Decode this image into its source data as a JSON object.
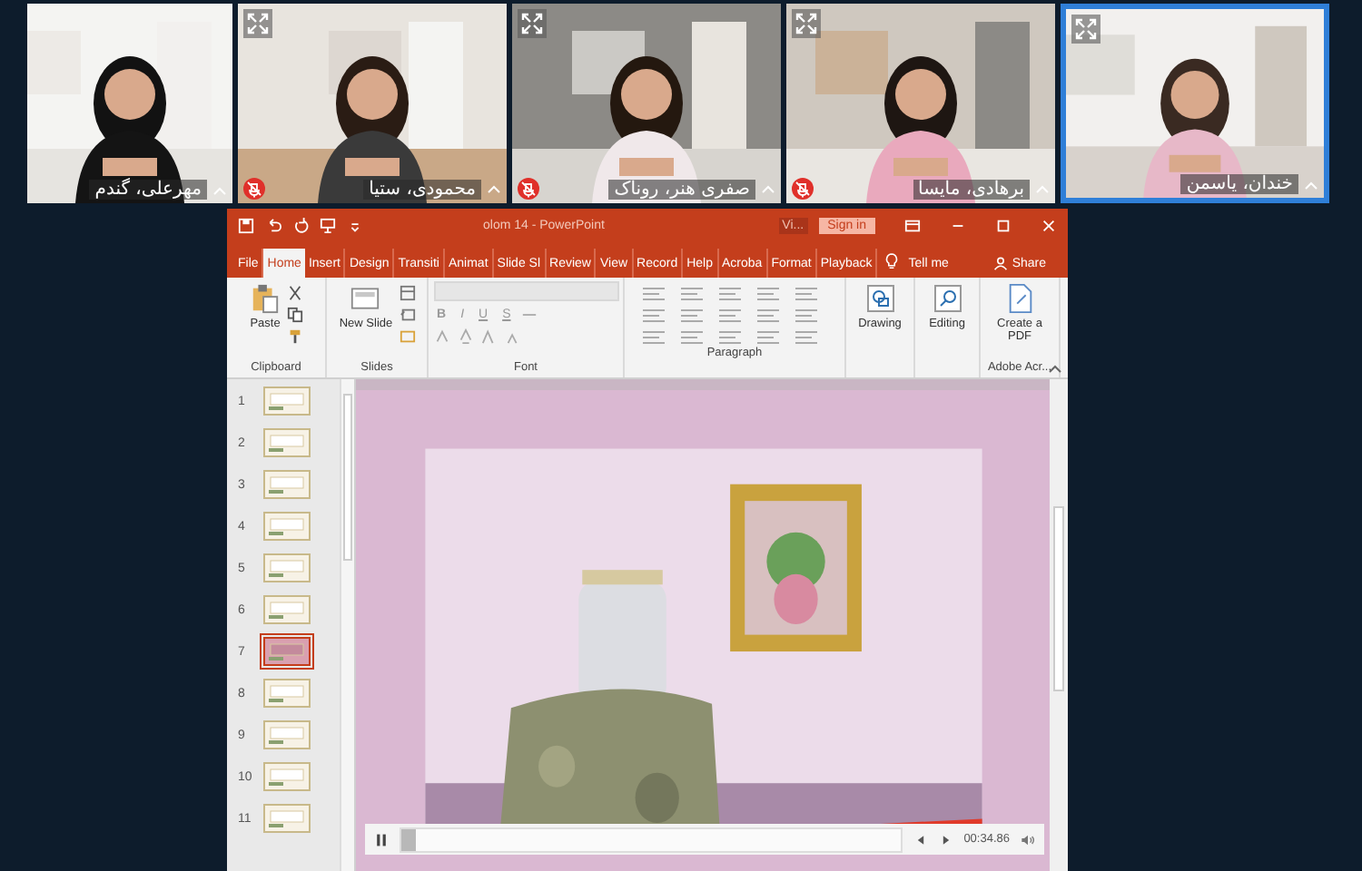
{
  "participants": [
    {
      "name": "خندان، یاسمن",
      "muted": false,
      "speaking": true,
      "maximize_button": true
    },
    {
      "name": "برهادی، مایسا",
      "muted": true,
      "speaking": false,
      "maximize_button": true
    },
    {
      "name": "صفری هنر، روناک",
      "muted": true,
      "speaking": false,
      "maximize_button": true
    },
    {
      "name": "محمودی، ستیا",
      "muted": true,
      "speaking": false,
      "maximize_button": true
    },
    {
      "name": "مهرعلی، گندم",
      "muted": false,
      "speaking": false,
      "maximize_button": false
    }
  ],
  "window": {
    "title": "olom 14  -  PowerPoint",
    "hint": "Vi...",
    "sign_in": "Sign in"
  },
  "tabs": [
    {
      "label": "File",
      "selected": false
    },
    {
      "label": "Home",
      "selected": true
    },
    {
      "label": "Insert",
      "selected": false
    },
    {
      "label": "Design",
      "selected": false
    },
    {
      "label": "Transiti",
      "selected": false
    },
    {
      "label": "Animat",
      "selected": false
    },
    {
      "label": "Slide Sl",
      "selected": false
    },
    {
      "label": "Review",
      "selected": false
    },
    {
      "label": "View",
      "selected": false
    },
    {
      "label": "Record",
      "selected": false
    },
    {
      "label": "Help",
      "selected": false
    },
    {
      "label": "Acroba",
      "selected": false
    },
    {
      "label": "Format",
      "selected": false
    },
    {
      "label": "Playback",
      "selected": false
    }
  ],
  "tell_me": "Tell me",
  "share": "Share",
  "ribbon": {
    "clipboard": {
      "label": "Clipboard",
      "paste": "Paste"
    },
    "slides": {
      "label": "Slides",
      "new_slide": "New Slide"
    },
    "font": {
      "label": "Font",
      "format_buttons": [
        "B",
        "I",
        "U",
        "S"
      ]
    },
    "paragraph": {
      "label": "Paragraph"
    },
    "drawing": {
      "label": "Drawing"
    },
    "editing": {
      "label": "Editing"
    },
    "adobe": {
      "label": "Adobe Acr...",
      "button": "Create a PDF"
    }
  },
  "slides": [
    {
      "number": "1",
      "selected": false
    },
    {
      "number": "2",
      "selected": false
    },
    {
      "number": "3",
      "selected": false
    },
    {
      "number": "4",
      "selected": false
    },
    {
      "number": "5",
      "selected": false
    },
    {
      "number": "6",
      "selected": false
    },
    {
      "number": "7",
      "selected": true
    },
    {
      "number": "8",
      "selected": false
    },
    {
      "number": "9",
      "selected": false
    },
    {
      "number": "10",
      "selected": false
    },
    {
      "number": "11",
      "selected": false
    }
  ],
  "player": {
    "level": 0.03,
    "time": "00:34.86"
  }
}
